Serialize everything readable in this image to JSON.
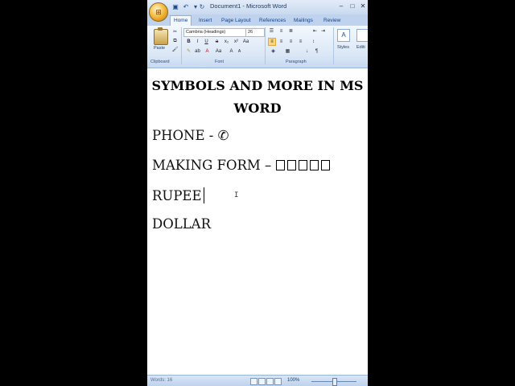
{
  "titlebar": {
    "title": "Document1 - Microsoft Word",
    "minimize": "–",
    "restore": "□",
    "close": "✕"
  },
  "tabs": [
    "Home",
    "Insert",
    "Page Layout",
    "References",
    "Mailings",
    "Review"
  ],
  "ribbon": {
    "paste_label": "Paste",
    "clipboard_label": "Clipboard",
    "font_label": "Font",
    "paragraph_label": "Paragraph",
    "styles_label": "Styles",
    "editing_label": "Editi",
    "font_name": "Cambria (Headings)",
    "font_size": "26",
    "bold": "B",
    "italic": "I",
    "underline": "U"
  },
  "document": {
    "heading": "SYMBOLS AND MORE IN MS WORD",
    "line1": "PHONE - ✆",
    "line2_text": "MAKING FORM – ",
    "line2_boxes": 5,
    "line3": "RUPEE",
    "line4": "DOLLAR"
  },
  "status": {
    "words": "Words: 16",
    "zoom": "100%"
  }
}
